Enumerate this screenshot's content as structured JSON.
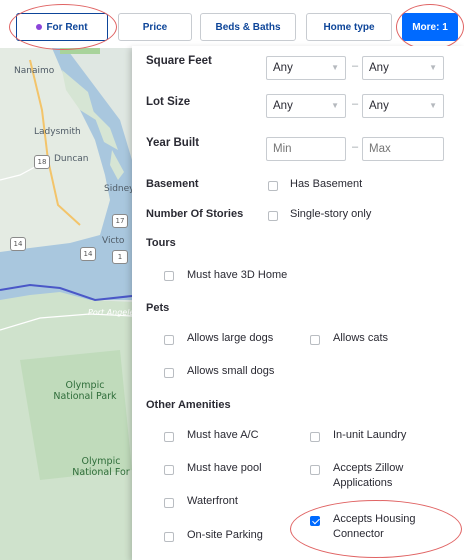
{
  "filters": {
    "for_rent": "For Rent",
    "price": "Price",
    "beds_baths": "Beds & Baths",
    "home_type": "Home type",
    "more": "More: 1"
  },
  "colors": {
    "accent": "#006aff",
    "link_text": "#0d4599",
    "rent_dot": "#8b44d9",
    "annotation_ring": "#e06464"
  },
  "map": {
    "labels": {
      "nanaimo": "Nanaimo",
      "ladysmith": "Ladysmith",
      "duncan": "Duncan",
      "sidney": "Sidney",
      "victoria": "Victo",
      "port_angeles": "Port Angeles",
      "olympic_np": "Olympic National Park",
      "olympic_nf": "Olympic National For"
    },
    "shields": {
      "s18": "18",
      "s14a": "14",
      "s14b": "14",
      "s17": "17",
      "s1": "1"
    }
  },
  "panel": {
    "square_feet": {
      "label": "Square Feet",
      "min": "Any",
      "max": "Any",
      "sep": "–"
    },
    "lot_size": {
      "label": "Lot Size",
      "min": "Any",
      "max": "Any",
      "sep": "–"
    },
    "year_built": {
      "label": "Year Built",
      "min_placeholder": "Min",
      "max_placeholder": "Max",
      "sep": "–"
    },
    "basement": {
      "label": "Basement",
      "option": "Has Basement",
      "checked": false
    },
    "stories": {
      "label": "Number Of Stories",
      "option": "Single-story only",
      "checked": false
    },
    "tours": {
      "label": "Tours",
      "option": "Must have 3D Home",
      "checked": false
    },
    "pets": {
      "label": "Pets",
      "large_dogs": "Allows large dogs",
      "cats": "Allows cats",
      "small_dogs": "Allows small dogs"
    },
    "amenities": {
      "label": "Other Amenities",
      "ac": "Must have A/C",
      "laundry": "In-unit Laundry",
      "pool": "Must have pool",
      "zillow_line1": "Accepts Zillow",
      "zillow_line2": "Applications",
      "waterfront": "Waterfront",
      "housing_line1": "Accepts Housing",
      "housing_line2": "Connector",
      "housing_checked": true,
      "parking": "On-site Parking"
    }
  }
}
